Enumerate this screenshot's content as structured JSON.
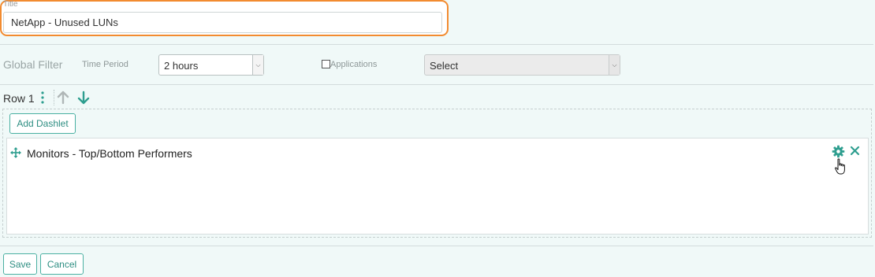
{
  "title_field": {
    "label": "Title",
    "value": "NetApp - Unused LUNs"
  },
  "global_filter": {
    "label": "Global Filter",
    "time_period_label": "Time Period",
    "time_period_value": "2 hours",
    "applications_label": "Applications",
    "applications_checked": false,
    "applications_select": "Select"
  },
  "row": {
    "label": "Row 1",
    "add_dashlet_label": "Add Dashlet",
    "icons": [
      "kebab-icon",
      "arrow-up-icon",
      "arrow-down-icon"
    ]
  },
  "dashlet": {
    "title": "Monitors - Top/Bottom Performers",
    "icons": [
      "move-icon",
      "gear-icon",
      "close-icon"
    ]
  },
  "footer": {
    "save_label": "Save",
    "cancel_label": "Cancel"
  },
  "colors": {
    "accent": "#2e9e8f",
    "title_border": "#f28b30",
    "background": "#f0f9f8"
  }
}
